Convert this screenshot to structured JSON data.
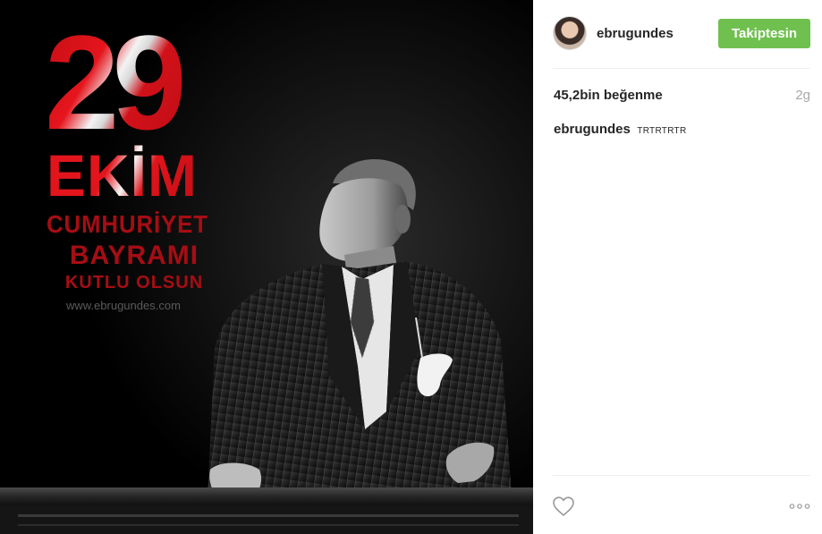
{
  "post": {
    "image": {
      "poster_number": "29",
      "poster_month": "EKİM",
      "poster_line1": "CUMHURİYET",
      "poster_line2": "BAYRAMI",
      "poster_line3": "KUTLU OLSUN",
      "poster_website": "www.ebrugundes.com"
    },
    "header": {
      "username": "ebrugundes",
      "follow_label": "Takiptesin"
    },
    "stats": {
      "likes": "45,2bin beğenme",
      "time_ago": "2g"
    },
    "caption": {
      "username": "ebrugundes",
      "text": "TRTRTRTR"
    },
    "actions": {
      "like_icon": "heart-outline-icon",
      "more_icon": "more-options-icon"
    }
  },
  "colors": {
    "follow_button": "#70c050",
    "poster_red": "#d10f16",
    "time_grey": "#a5a7aa"
  }
}
